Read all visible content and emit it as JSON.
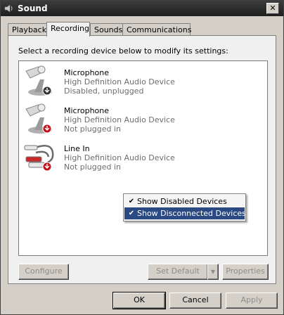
{
  "window": {
    "title": "Sound"
  },
  "tabs": [
    {
      "label": "Playback"
    },
    {
      "label": "Recording"
    },
    {
      "label": "Sounds"
    },
    {
      "label": "Communications"
    }
  ],
  "panel": {
    "instruction": "Select a recording device below to modify its settings:",
    "devices": [
      {
        "name": "Microphone",
        "driver": "High Definition Audio Device",
        "status": "Disabled, unplugged",
        "icon": "microphone-icon"
      },
      {
        "name": "Microphone",
        "driver": "High Definition Audio Device",
        "status": "Not plugged in",
        "icon": "microphone-icon"
      },
      {
        "name": "Line In",
        "driver": "High Definition Audio Device",
        "status": "Not plugged in",
        "icon": "rca-cable-icon"
      }
    ]
  },
  "context_menu": {
    "items": [
      {
        "label": "Show Disabled Devices",
        "checked": true
      },
      {
        "label": "Show Disconnected Devices",
        "checked": true
      }
    ]
  },
  "buttons": {
    "configure": "Configure",
    "set_default": "Set Default",
    "properties": "Properties",
    "ok": "OK",
    "cancel": "Cancel",
    "apply": "Apply"
  },
  "colors": {
    "selection": "#2b4a83",
    "disabled_status_dot": "#333333",
    "unplugged_status_dot": "#c0101a"
  }
}
